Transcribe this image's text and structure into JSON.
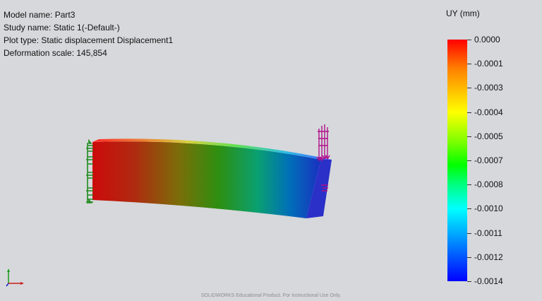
{
  "info": {
    "model": "Model name: Part3",
    "study": "Study name: Static 1(-Default-)",
    "plot": "Plot type: Static displacement Displacement1",
    "scale": "Deformation scale: 145,854"
  },
  "legend": {
    "title": "UY (mm)",
    "labels": [
      "0.0000",
      "-0.0001",
      "-0.0003",
      "-0.0004",
      "-0.0005",
      "-0.0007",
      "-0.0008",
      "-0.0010",
      "-0.0011",
      "-0.0012",
      "-0.0014"
    ],
    "colors": [
      "#ff0000",
      "#ff8000",
      "#ffff00",
      "#80ff00",
      "#00ff00",
      "#00ff80",
      "#00ffff",
      "#0080ff",
      "#0000ff"
    ]
  },
  "watermark": "SOLIDWORKS Educational Product. For Instructional Use Only.",
  "icons": {
    "fixture": "green-fixture-arrows-icon",
    "load": "magenta-load-arrows-icon",
    "axes": "coordinate-triad-icon"
  }
}
